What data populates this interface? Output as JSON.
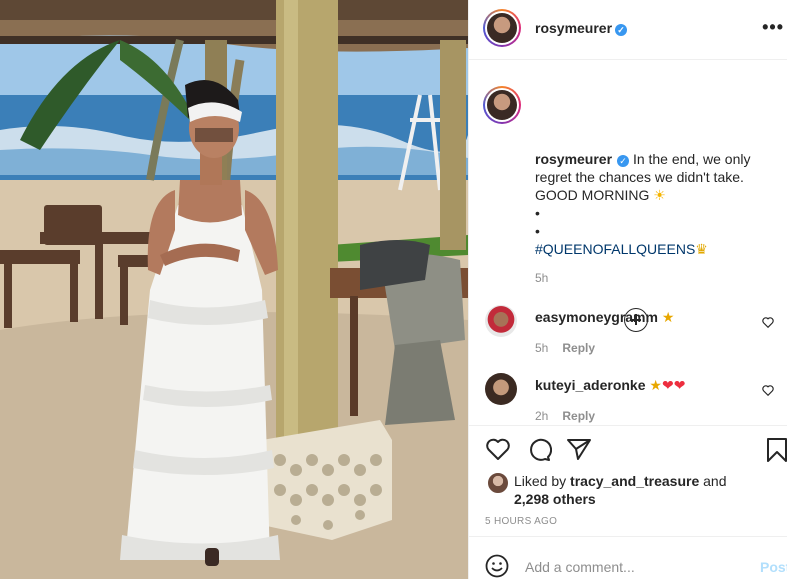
{
  "post": {
    "author": "rosymeurer",
    "verified": true,
    "caption_lines": [
      "In the end, we only regret the chances we didn't take.",
      "GOOD MORNING",
      "•",
      "•",
      "#QUEENOFALLQUEENS"
    ],
    "caption_time": "5h",
    "likes_prefix": "Liked by",
    "liked_by_user": "tracy_and_treasure",
    "likes_and": "and",
    "likes_others": "2,298 others",
    "timestamp": "5 HOURS AGO"
  },
  "comments": [
    {
      "user": "easymoneygramm",
      "time": "5h",
      "reply_label": "Reply",
      "emoji_icons": [
        "star-struck-icon"
      ]
    },
    {
      "user": "kuteyi_aderonke",
      "time": "2h",
      "reply_label": "Reply",
      "emoji_icons": [
        "star-struck-icon",
        "red-heart-icon",
        "red-heart-icon"
      ]
    }
  ],
  "composer": {
    "placeholder": "Add a comment...",
    "post_label": "Post"
  },
  "icons": {
    "verified": "verified-badge-icon",
    "more": "more-options-icon",
    "load_more": "plus-circle-icon",
    "like": "heart-outline-icon",
    "comment": "comment-bubble-icon",
    "share": "paper-plane-icon",
    "save": "bookmark-icon",
    "emoji": "smiley-face-icon"
  },
  "colors": {
    "verified_blue": "#3897f0",
    "hashtag": "#00376b",
    "muted": "#8e8e8e",
    "post_disabled": "#b2dffc",
    "divider": "#efefef"
  }
}
